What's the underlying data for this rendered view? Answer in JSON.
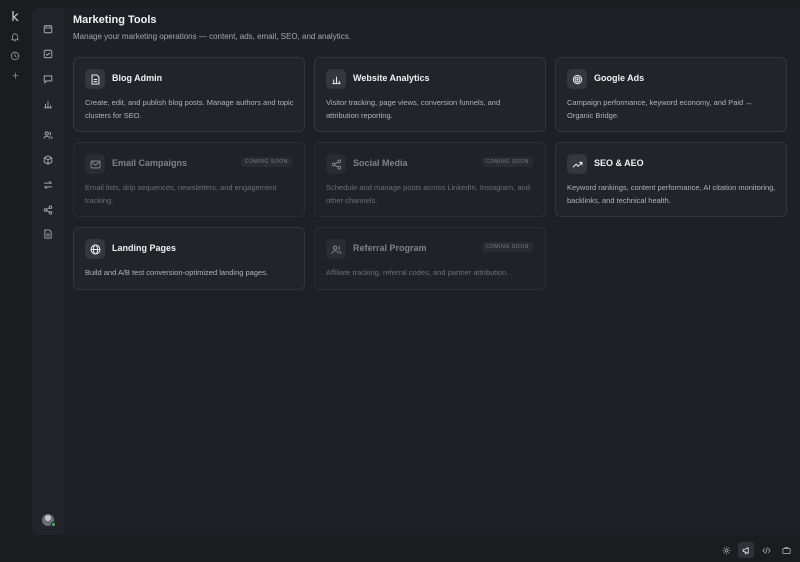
{
  "rail": {
    "logo": "k",
    "icons": [
      "bell-icon",
      "history-icon",
      "plus-icon"
    ]
  },
  "sidebar": {
    "items": [
      "calendar-icon",
      "checkbox-icon",
      "chat-icon",
      "bar-chart-icon",
      "users-icon",
      "box-icon",
      "transfer-icon",
      "share-icon",
      "document-icon"
    ]
  },
  "page": {
    "title": "Marketing Tools",
    "subtitle": "Manage your marketing operations — content, ads, email, SEO, and analytics."
  },
  "cards": [
    {
      "title": "Blog Admin",
      "desc": "Create, edit, and publish blog posts. Manage authors and topic clusters for SEO.",
      "icon": "document-icon",
      "badge": ""
    },
    {
      "title": "Website Analytics",
      "desc": "Visitor tracking, page views, conversion funnels, and attribution reporting.",
      "icon": "bar-chart-icon",
      "badge": ""
    },
    {
      "title": "Google Ads",
      "desc": "Campaign performance, keyword economy, and Paid ↔ Organic Bridge.",
      "icon": "target-icon",
      "badge": ""
    },
    {
      "title": "Email Campaigns",
      "desc": "Email lists, drip sequences, newsletters, and engagement tracking.",
      "icon": "mail-icon",
      "badge": "COMING SOON"
    },
    {
      "title": "Social Media",
      "desc": "Schedule and manage posts across LinkedIn, Instagram, and other channels.",
      "icon": "share-icon",
      "badge": "COMING SOON"
    },
    {
      "title": "SEO & AEO",
      "desc": "Keyword rankings, content performance, AI citation monitoring, backlinks, and technical health.",
      "icon": "trending-up-icon",
      "badge": ""
    },
    {
      "title": "Landing Pages",
      "desc": "Build and A/B test conversion-optimized landing pages.",
      "icon": "globe-icon",
      "badge": ""
    },
    {
      "title": "Referral Program",
      "desc": "Affiliate tracking, referral codes, and partner attribution.",
      "icon": "users-icon",
      "badge": "COMING SOON"
    }
  ],
  "status_bar": {
    "icons": [
      "gear-icon",
      "megaphone-icon",
      "code-icon",
      "briefcase-icon"
    ],
    "active": "megaphone-icon"
  }
}
